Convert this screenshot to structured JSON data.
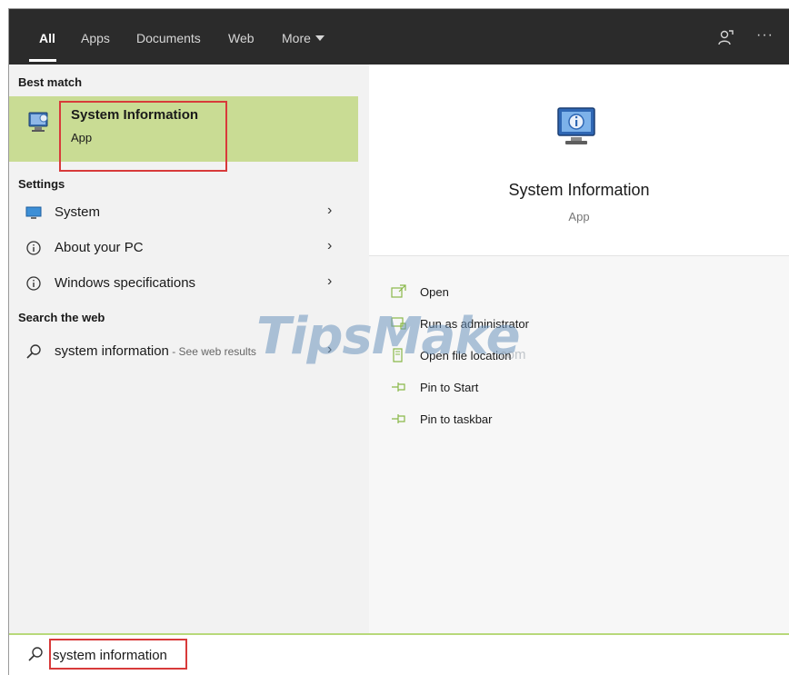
{
  "tabs": [
    {
      "label": "All"
    },
    {
      "label": "Apps"
    },
    {
      "label": "Documents"
    },
    {
      "label": "Web"
    },
    {
      "label": "More"
    }
  ],
  "topbar": {
    "more_dots": "···"
  },
  "left": {
    "best_match_heading": "Best match",
    "best_match": {
      "title": "System Information",
      "subtitle": "App"
    },
    "settings_heading": "Settings",
    "settings_items": [
      {
        "label": "System",
        "icon": "monitor-icon"
      },
      {
        "label": "About your PC",
        "icon": "info-icon"
      },
      {
        "label": "Windows specifications",
        "icon": "info-icon"
      }
    ],
    "web_heading": "Search the web",
    "web_item": {
      "label": "system information",
      "suffix": " - See web results"
    },
    "chevron": "›"
  },
  "right": {
    "title": "System Information",
    "subtitle": "App",
    "actions": [
      {
        "label": "Open",
        "icon": "open-icon"
      },
      {
        "label": "Run as administrator",
        "icon": "run-as-admin-icon"
      },
      {
        "label": "Open file location",
        "icon": "folder-icon"
      },
      {
        "label": "Pin to Start",
        "icon": "pin-icon"
      },
      {
        "label": "Pin to taskbar",
        "icon": "pin-icon"
      }
    ]
  },
  "watermark": {
    "text": "TipsMake",
    "suffix": ".com"
  },
  "search": {
    "value": "system information"
  },
  "colors": {
    "accent": "#c9dc94",
    "highlight_border": "#d83a3a",
    "topbar": "#2b2b2b"
  }
}
